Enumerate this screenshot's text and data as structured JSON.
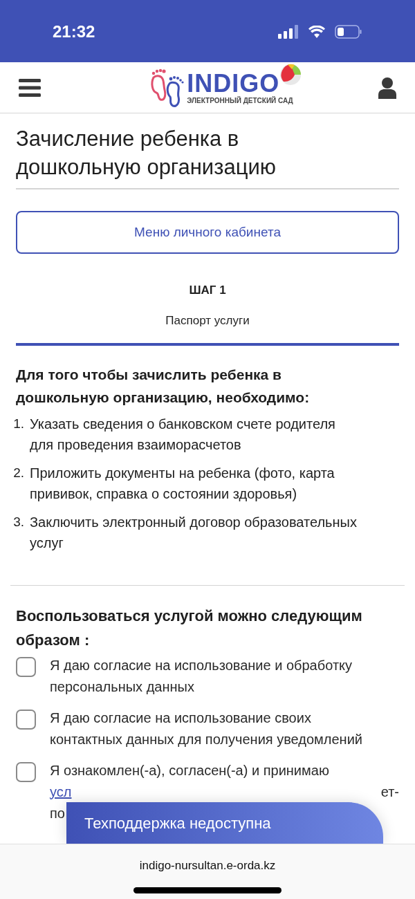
{
  "status_bar": {
    "time": "21:32"
  },
  "header": {
    "logo": {
      "name": "INDIGO",
      "tagline": "ЭЛЕКТРОННЫЙ ДЕТСКИЙ САД"
    }
  },
  "page": {
    "title": "Зачисление ребенка в дошкольную организацию",
    "cabinet_button": "Меню личного кабинета",
    "step": {
      "label": "ШАГ 1",
      "name": "Паспорт услуги"
    },
    "requirements": {
      "heading": "Для того чтобы зачислить ребенка в дошкольную организацию, необходимо:",
      "items": [
        {
          "number": "1.",
          "text": "Указать сведения о банковском счете родителя для проведения взаиморасчетов"
        },
        {
          "number": "2.",
          "text": "Приложить документы на ребенка (фото, карта прививок, справка о состоянии здоровья)"
        },
        {
          "number": "3.",
          "text": "Заключить электронный договор образовательных услуг"
        }
      ]
    },
    "consents": {
      "heading": "Воспользоваться услугой можно следующим образом :",
      "items": [
        {
          "checked": false,
          "text": "Я даю согласие на использование и обработку персональных данных"
        },
        {
          "checked": false,
          "text": "Я даю согласие на использование своих контактных данных для получения уведомлений"
        },
        {
          "checked": false,
          "text": "Я ознакомлен(-а), согласен(-а) и принимаю",
          "link": "усл",
          "fragments": [
            "ет-",
            "по"
          ]
        }
      ]
    }
  },
  "support_banner": {
    "text": "Техподдержка недоступна"
  },
  "browser_bar": {
    "url": "indigo-nursultan.e-orda.kz"
  }
}
